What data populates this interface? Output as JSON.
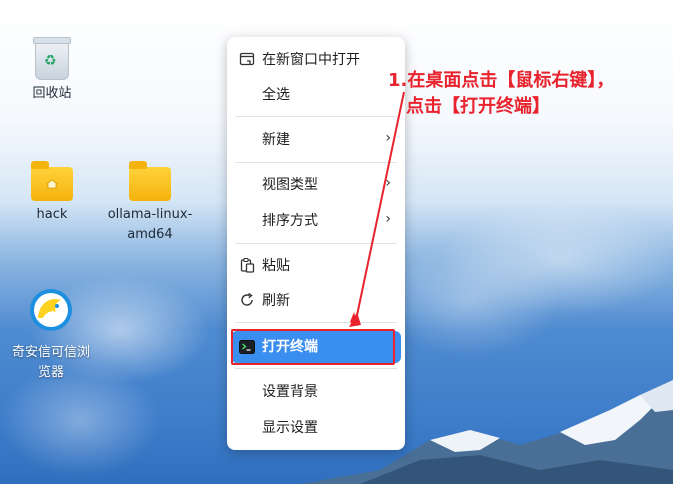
{
  "desktop": {
    "icons": [
      {
        "label": "回收站",
        "icon": "recycle-bin-icon"
      },
      {
        "label": "hack",
        "icon": "home-folder-icon"
      },
      {
        "label": "ollama-linux-amd64",
        "label_line1": "ollama-linux-",
        "label_line2": "amd64",
        "icon": "folder-icon"
      },
      {
        "label": "奇安信可信浏览器",
        "label_line1": "奇安信可信浏",
        "label_line2": "览器",
        "icon": "browser-icon"
      }
    ]
  },
  "context_menu": {
    "items": [
      {
        "label": "在新窗口中打开",
        "icon": "new-window-icon"
      },
      {
        "label": "全选"
      },
      {
        "label": "新建",
        "submenu": true
      },
      {
        "label": "视图类型",
        "submenu": true
      },
      {
        "label": "排序方式",
        "submenu": true
      },
      {
        "label": "粘贴",
        "icon": "paste-icon"
      },
      {
        "label": "刷新",
        "icon": "refresh-icon"
      },
      {
        "label": "打开终端",
        "icon": "terminal-icon",
        "highlighted": true
      },
      {
        "label": "设置背景"
      },
      {
        "label": "显示设置"
      }
    ]
  },
  "annotation": {
    "line1": "1.在桌面点击【鼠标右键】，",
    "line2": "点击【打开终端】",
    "color": "#e8232d"
  },
  "colors": {
    "highlight": "#3a8ef0",
    "folder": "#f5b30e"
  }
}
